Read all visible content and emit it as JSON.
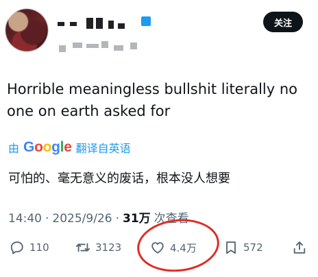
{
  "header": {
    "follow_label": "关注"
  },
  "tweet": {
    "text": "Horrible meaningless bullshit literally no one on earth asked for",
    "translate": {
      "prefix": "由",
      "google": "Google",
      "suffix": "翻译自英语"
    },
    "translated_text": "可怕的、毫无意义的废话，根本没人想要",
    "meta": {
      "time": "14:40",
      "sep": "·",
      "date": "2025/9/26",
      "sep2": "·",
      "views": "31万",
      "views_label": "次查看"
    }
  },
  "actions": {
    "reply_count": "110",
    "retweet_count": "3123",
    "like_count": "4.4万",
    "bookmark_count": "572"
  },
  "colors": {
    "accent": "#1d9bf0",
    "annotation": "#e02b22",
    "muted": "#536471"
  }
}
